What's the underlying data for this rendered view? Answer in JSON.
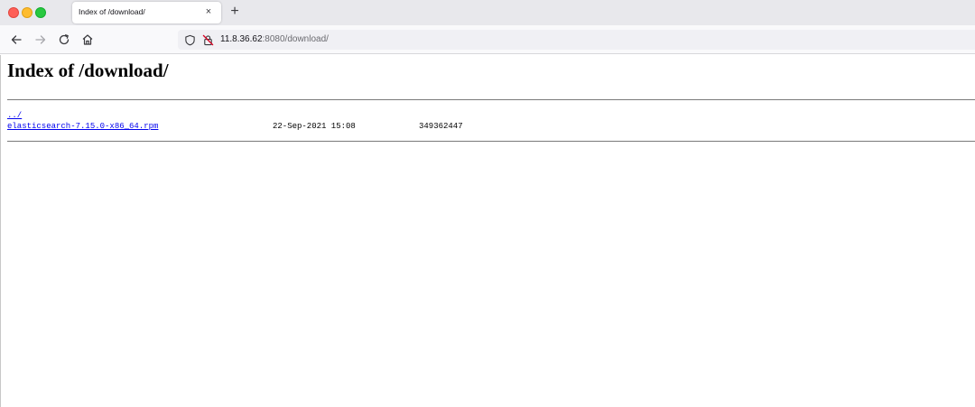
{
  "tab": {
    "title": "Index of /download/",
    "close_glyph": "×",
    "new_tab_glyph": "+"
  },
  "toolbar": {
    "url_host": "11.8.36.62",
    "url_rest": ":8080/download/"
  },
  "page": {
    "heading": "Index of /download/",
    "entries": [
      {
        "name": "../",
        "date": "",
        "size": ""
      },
      {
        "name": "elasticsearch-7.15.0-x86_64.rpm",
        "date": "22-Sep-2021 15:08",
        "size": "349362447"
      }
    ]
  },
  "icons": {
    "back": "back-arrow-icon",
    "forward": "forward-arrow-icon",
    "reload": "reload-icon",
    "home": "home-icon",
    "shield": "shield-icon",
    "lock": "insecure-lock-icon"
  },
  "colors": {
    "link": "#0000ee",
    "traffic_red": "#fe5f57",
    "traffic_yellow": "#febc2e",
    "traffic_green": "#28c840",
    "insecure_lock": "#d70022"
  }
}
